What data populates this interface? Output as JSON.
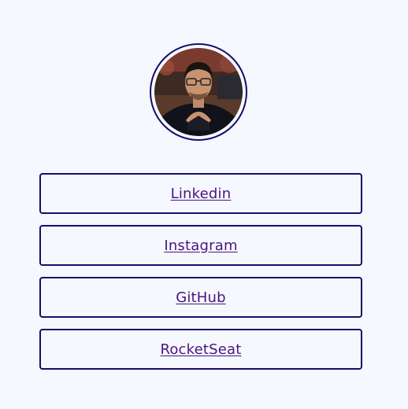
{
  "profile": {
    "avatar_alt": "profile photo"
  },
  "links": [
    {
      "label": "Linkedin"
    },
    {
      "label": "Instagram"
    },
    {
      "label": "GitHub"
    },
    {
      "label": "RocketSeat"
    }
  ],
  "colors": {
    "background": "#f5f9ff",
    "border": "#1b0a6b",
    "link_text": "#4b137f"
  }
}
